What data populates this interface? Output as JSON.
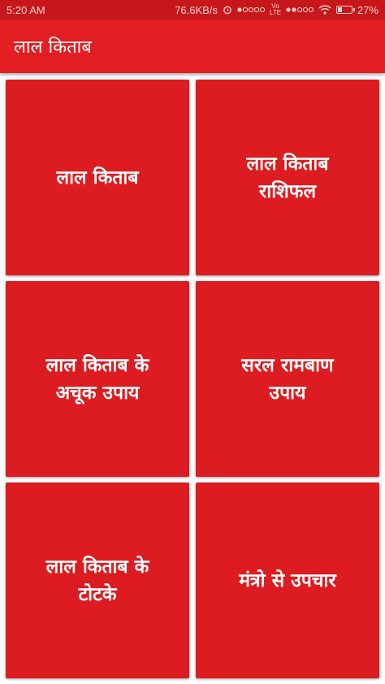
{
  "status_bar": {
    "time": "5:20 AM",
    "net_speed": "76.6KB/s",
    "carrier": "Vo LTE",
    "battery_percent": "27%",
    "battery_level": 0.27,
    "icons": [
      "alarm-icon",
      "signal-dots-icon",
      "lte-signal-icon",
      "wifi-icon",
      "battery-icon"
    ]
  },
  "app_bar": {
    "title": "लाल किताब"
  },
  "colors": {
    "status_bar": "#c8171b",
    "app_bar": "#e21e22",
    "tile": "#dc1c20",
    "text": "#ffffff"
  },
  "tiles": [
    {
      "label": "लाल किताब"
    },
    {
      "label": "लाल किताब\nराशिफल"
    },
    {
      "label": "लाल किताब के\nअचूक उपाय"
    },
    {
      "label": "सरल रामबाण\nउपाय"
    },
    {
      "label": "लाल किताब के\nटोटके"
    },
    {
      "label": "मंत्रो से उपचार"
    }
  ]
}
